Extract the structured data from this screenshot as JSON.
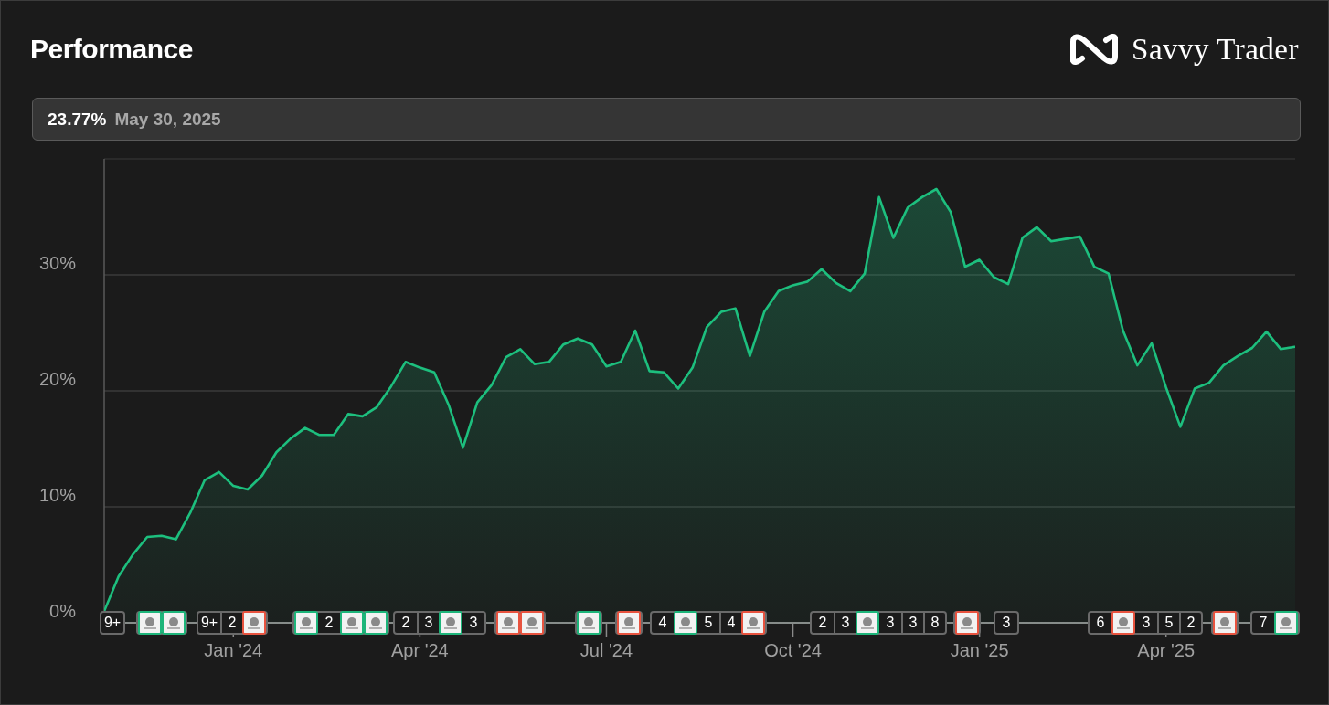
{
  "header": {
    "title": "Performance",
    "brand": "Savvy Trader"
  },
  "summary": {
    "value": "23.77%",
    "date": "May 30, 2025"
  },
  "chart": {
    "chart_data": {
      "type": "area",
      "categories": [
        null,
        null,
        null,
        null,
        null,
        null,
        null,
        null,
        null,
        "Jan '24",
        null,
        null,
        null,
        null,
        null,
        null,
        null,
        null,
        null,
        null,
        null,
        null,
        "Apr '24",
        null,
        null,
        null,
        null,
        null,
        null,
        null,
        null,
        null,
        null,
        null,
        null,
        "Jul '24",
        null,
        null,
        null,
        null,
        null,
        null,
        null,
        null,
        null,
        null,
        null,
        null,
        "Oct '24",
        null,
        null,
        null,
        null,
        null,
        null,
        null,
        null,
        null,
        null,
        null,
        null,
        "Jan '25",
        null,
        null,
        null,
        null,
        null,
        null,
        null,
        null,
        null,
        null,
        null,
        null,
        "Apr '25",
        null,
        null,
        null,
        null,
        null,
        null,
        null,
        null,
        null
      ],
      "series": [
        {
          "color": "#1dbf7e",
          "values": [
            1.0,
            4.0,
            5.9,
            7.4,
            7.5,
            7.2,
            9.5,
            12.3,
            13.0,
            11.8,
            11.5,
            12.7,
            14.7,
            15.9,
            16.8,
            16.2,
            16.2,
            18.0,
            17.8,
            18.6,
            20.4,
            22.5,
            22.0,
            21.6,
            18.8,
            15.1,
            19.0,
            20.5,
            22.9,
            23.6,
            22.3,
            22.5,
            24.0,
            24.5,
            24.0,
            22.1,
            22.5,
            25.2,
            21.7,
            21.6,
            20.2,
            22.0,
            25.5,
            26.8,
            27.1,
            23.0,
            26.8,
            28.6,
            29.1,
            29.4,
            30.5,
            29.3,
            28.6,
            30.1,
            36.7,
            33.2,
            35.8,
            36.7,
            37.4,
            35.4,
            30.7,
            31.3,
            29.8,
            29.2,
            33.2,
            34.1,
            32.9,
            33.1,
            33.3,
            30.7,
            30.1,
            25.2,
            22.2,
            24.1,
            20.3,
            16.9,
            20.2,
            20.7,
            22.2,
            23.0,
            23.7,
            25.1,
            23.6,
            23.8
          ]
        }
      ],
      "ylim": [
        0,
        40
      ],
      "grid": true,
      "yticks": [
        {
          "value": 0,
          "label": "0%"
        },
        {
          "value": 10,
          "label": "10%"
        },
        {
          "value": 20,
          "label": "20%"
        },
        {
          "value": 30,
          "label": "30%"
        }
      ]
    },
    "markers": [
      {
        "items": [
          {
            "kind": "count",
            "label": "9+"
          }
        ]
      },
      {
        "items": [
          {
            "kind": "logo",
            "color": "#1db57a"
          },
          {
            "kind": "logo",
            "color": "#1db57a"
          }
        ]
      },
      {
        "items": [
          {
            "kind": "count",
            "label": "9+"
          },
          {
            "kind": "count",
            "label": "2"
          },
          {
            "kind": "logo",
            "color": "#e8533f"
          }
        ]
      },
      {
        "items": [
          {
            "kind": "logo",
            "color": "#1db57a"
          },
          {
            "kind": "count",
            "label": "2"
          },
          {
            "kind": "logo",
            "color": "#1db57a"
          },
          {
            "kind": "logo",
            "color": "#1db57a"
          }
        ]
      },
      {
        "items": [
          {
            "kind": "count",
            "label": "2"
          },
          {
            "kind": "count",
            "label": "3"
          },
          {
            "kind": "logo",
            "color": "#1db57a"
          },
          {
            "kind": "count",
            "label": "3"
          }
        ]
      },
      {
        "items": [
          {
            "kind": "logo",
            "color": "#e8533f"
          },
          {
            "kind": "logo",
            "color": "#e8533f"
          }
        ]
      },
      {
        "items": [
          {
            "kind": "logo",
            "color": "#1db57a"
          }
        ]
      },
      {
        "items": [
          {
            "kind": "logo",
            "color": "#e8533f"
          }
        ]
      },
      {
        "items": [
          {
            "kind": "count",
            "label": "4"
          },
          {
            "kind": "logo",
            "color": "#1db57a"
          },
          {
            "kind": "count",
            "label": "5"
          },
          {
            "kind": "count",
            "label": "4"
          },
          {
            "kind": "logo",
            "color": "#e8533f"
          }
        ]
      },
      {
        "items": [
          {
            "kind": "count",
            "label": "2"
          },
          {
            "kind": "count",
            "label": "3"
          },
          {
            "kind": "logo",
            "color": "#1db57a"
          },
          {
            "kind": "count",
            "label": "3"
          },
          {
            "kind": "count",
            "label": "3"
          },
          {
            "kind": "count",
            "label": "8"
          }
        ]
      },
      {
        "items": [
          {
            "kind": "logo",
            "color": "#e8533f"
          }
        ]
      },
      {
        "items": [
          {
            "kind": "count",
            "label": "3"
          }
        ]
      },
      {
        "items": [
          {
            "kind": "count",
            "label": "6"
          },
          {
            "kind": "logo",
            "color": "#e8533f"
          },
          {
            "kind": "count",
            "label": "3"
          },
          {
            "kind": "count",
            "label": "5"
          },
          {
            "kind": "count",
            "label": "2"
          }
        ]
      },
      {
        "items": [
          {
            "kind": "logo",
            "color": "#e8533f"
          }
        ]
      },
      {
        "items": [
          {
            "kind": "count",
            "label": "7"
          },
          {
            "kind": "logo",
            "color": "#1db57a"
          }
        ]
      }
    ]
  }
}
